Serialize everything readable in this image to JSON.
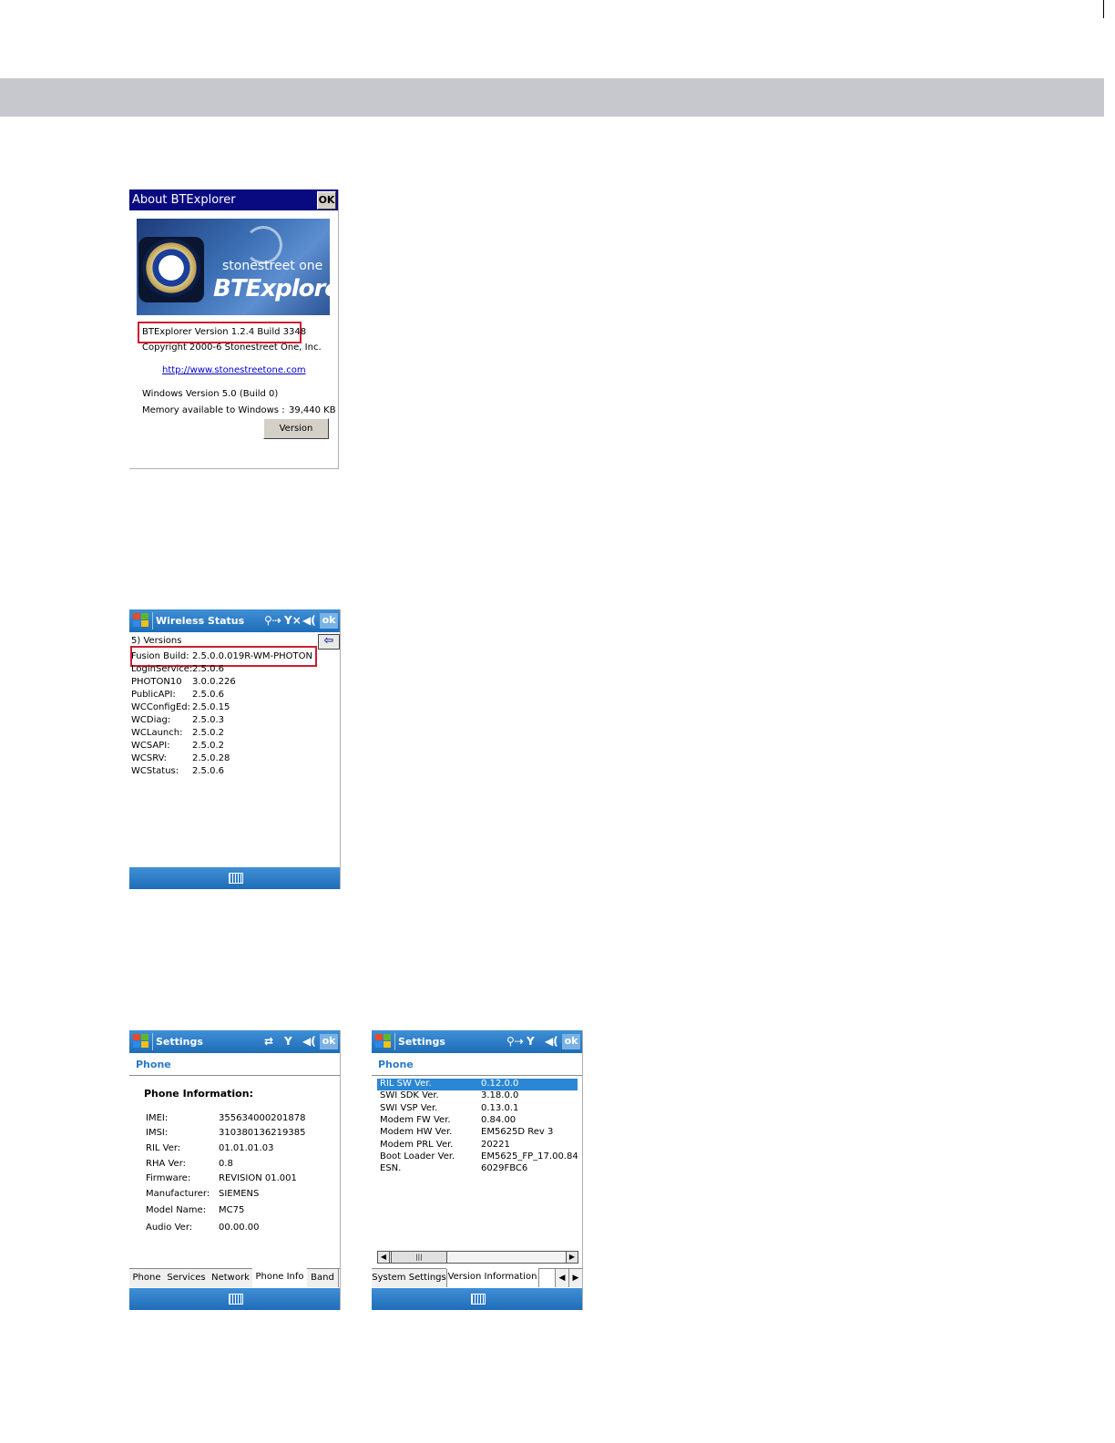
{
  "bt": {
    "title": "About BTExplorer",
    "ok": "OK",
    "logo_tagline": "stonestreet one",
    "logo_name": "BTExplorer",
    "version_line": "BTExplorer Version 1.2.4  Build 3348",
    "copyright": "Copyright 2000-6 Stonestreet One, Inc.",
    "url": "http://www.stonestreetone.com",
    "windows_version": "Windows Version 5.0 (Build 0)",
    "memory_label": "Memory available to Windows :",
    "memory_value": "39,440 KB",
    "version_button": "Version"
  },
  "ws": {
    "title": "Wireless Status",
    "ok": "ok",
    "section": "5) Versions",
    "rows": [
      {
        "k": "Fusion Build:",
        "v": "2.5.0.0.019R-WM-PHOTON"
      },
      {
        "k": "LoginService:",
        "v": "2.5.0.6"
      },
      {
        "k": "PHOTON10",
        "v": "3.0.0.226"
      },
      {
        "k": "PublicAPI:",
        "v": "2.5.0.6"
      },
      {
        "k": "WCConfigEd:",
        "v": "2.5.0.15"
      },
      {
        "k": "WCDiag:",
        "v": "2.5.0.3"
      },
      {
        "k": "WCLaunch:",
        "v": "2.5.0.2"
      },
      {
        "k": "WCSAPI:",
        "v": "2.5.0.2"
      },
      {
        "k": "WCSRV:",
        "v": "2.5.0.28"
      },
      {
        "k": "WCStatus:",
        "v": "2.5.0.6"
      }
    ]
  },
  "s1": {
    "title": "Settings",
    "ok": "ok",
    "header": "Phone",
    "section": "Phone Information:",
    "rows": [
      {
        "k": "IMEI:",
        "v": "355634000201878"
      },
      {
        "k": "IMSI:",
        "v": "310380136219385"
      },
      {
        "k": "RIL Ver:",
        "v": "01.01.01.03"
      },
      {
        "k": "RHA Ver:",
        "v": "0.8"
      },
      {
        "k": "Firmware:",
        "v": "REVISION 01.001"
      },
      {
        "k": "Manufacturer:",
        "v": "SIEMENS"
      },
      {
        "k": "Model Name:",
        "v": "MC75"
      },
      {
        "k": "Audio Ver:",
        "v": "00.00.00"
      }
    ],
    "tabs": [
      "Phone",
      "Services",
      "Network",
      "Phone Info",
      "Band"
    ]
  },
  "s2": {
    "title": "Settings",
    "ok": "ok",
    "header": "Phone",
    "rows": [
      {
        "k": "RIL SW Ver.",
        "v": "0.12.0.0"
      },
      {
        "k": "SWI SDK Ver.",
        "v": "3.18.0.0"
      },
      {
        "k": "SWI VSP Ver.",
        "v": "0.13.0.1"
      },
      {
        "k": "Modem FW Ver.",
        "v": "0.84.00"
      },
      {
        "k": "Modem HW Ver.",
        "v": "EM5625D Rev 3"
      },
      {
        "k": "Modem PRL Ver.",
        "v": "20221"
      },
      {
        "k": "Boot Loader Ver.",
        "v": "EM5625_FP_17.00.84"
      },
      {
        "k": "ESN.",
        "v": "6029FBC6"
      }
    ],
    "tabs": [
      "System Settings",
      "Version Information"
    ]
  }
}
